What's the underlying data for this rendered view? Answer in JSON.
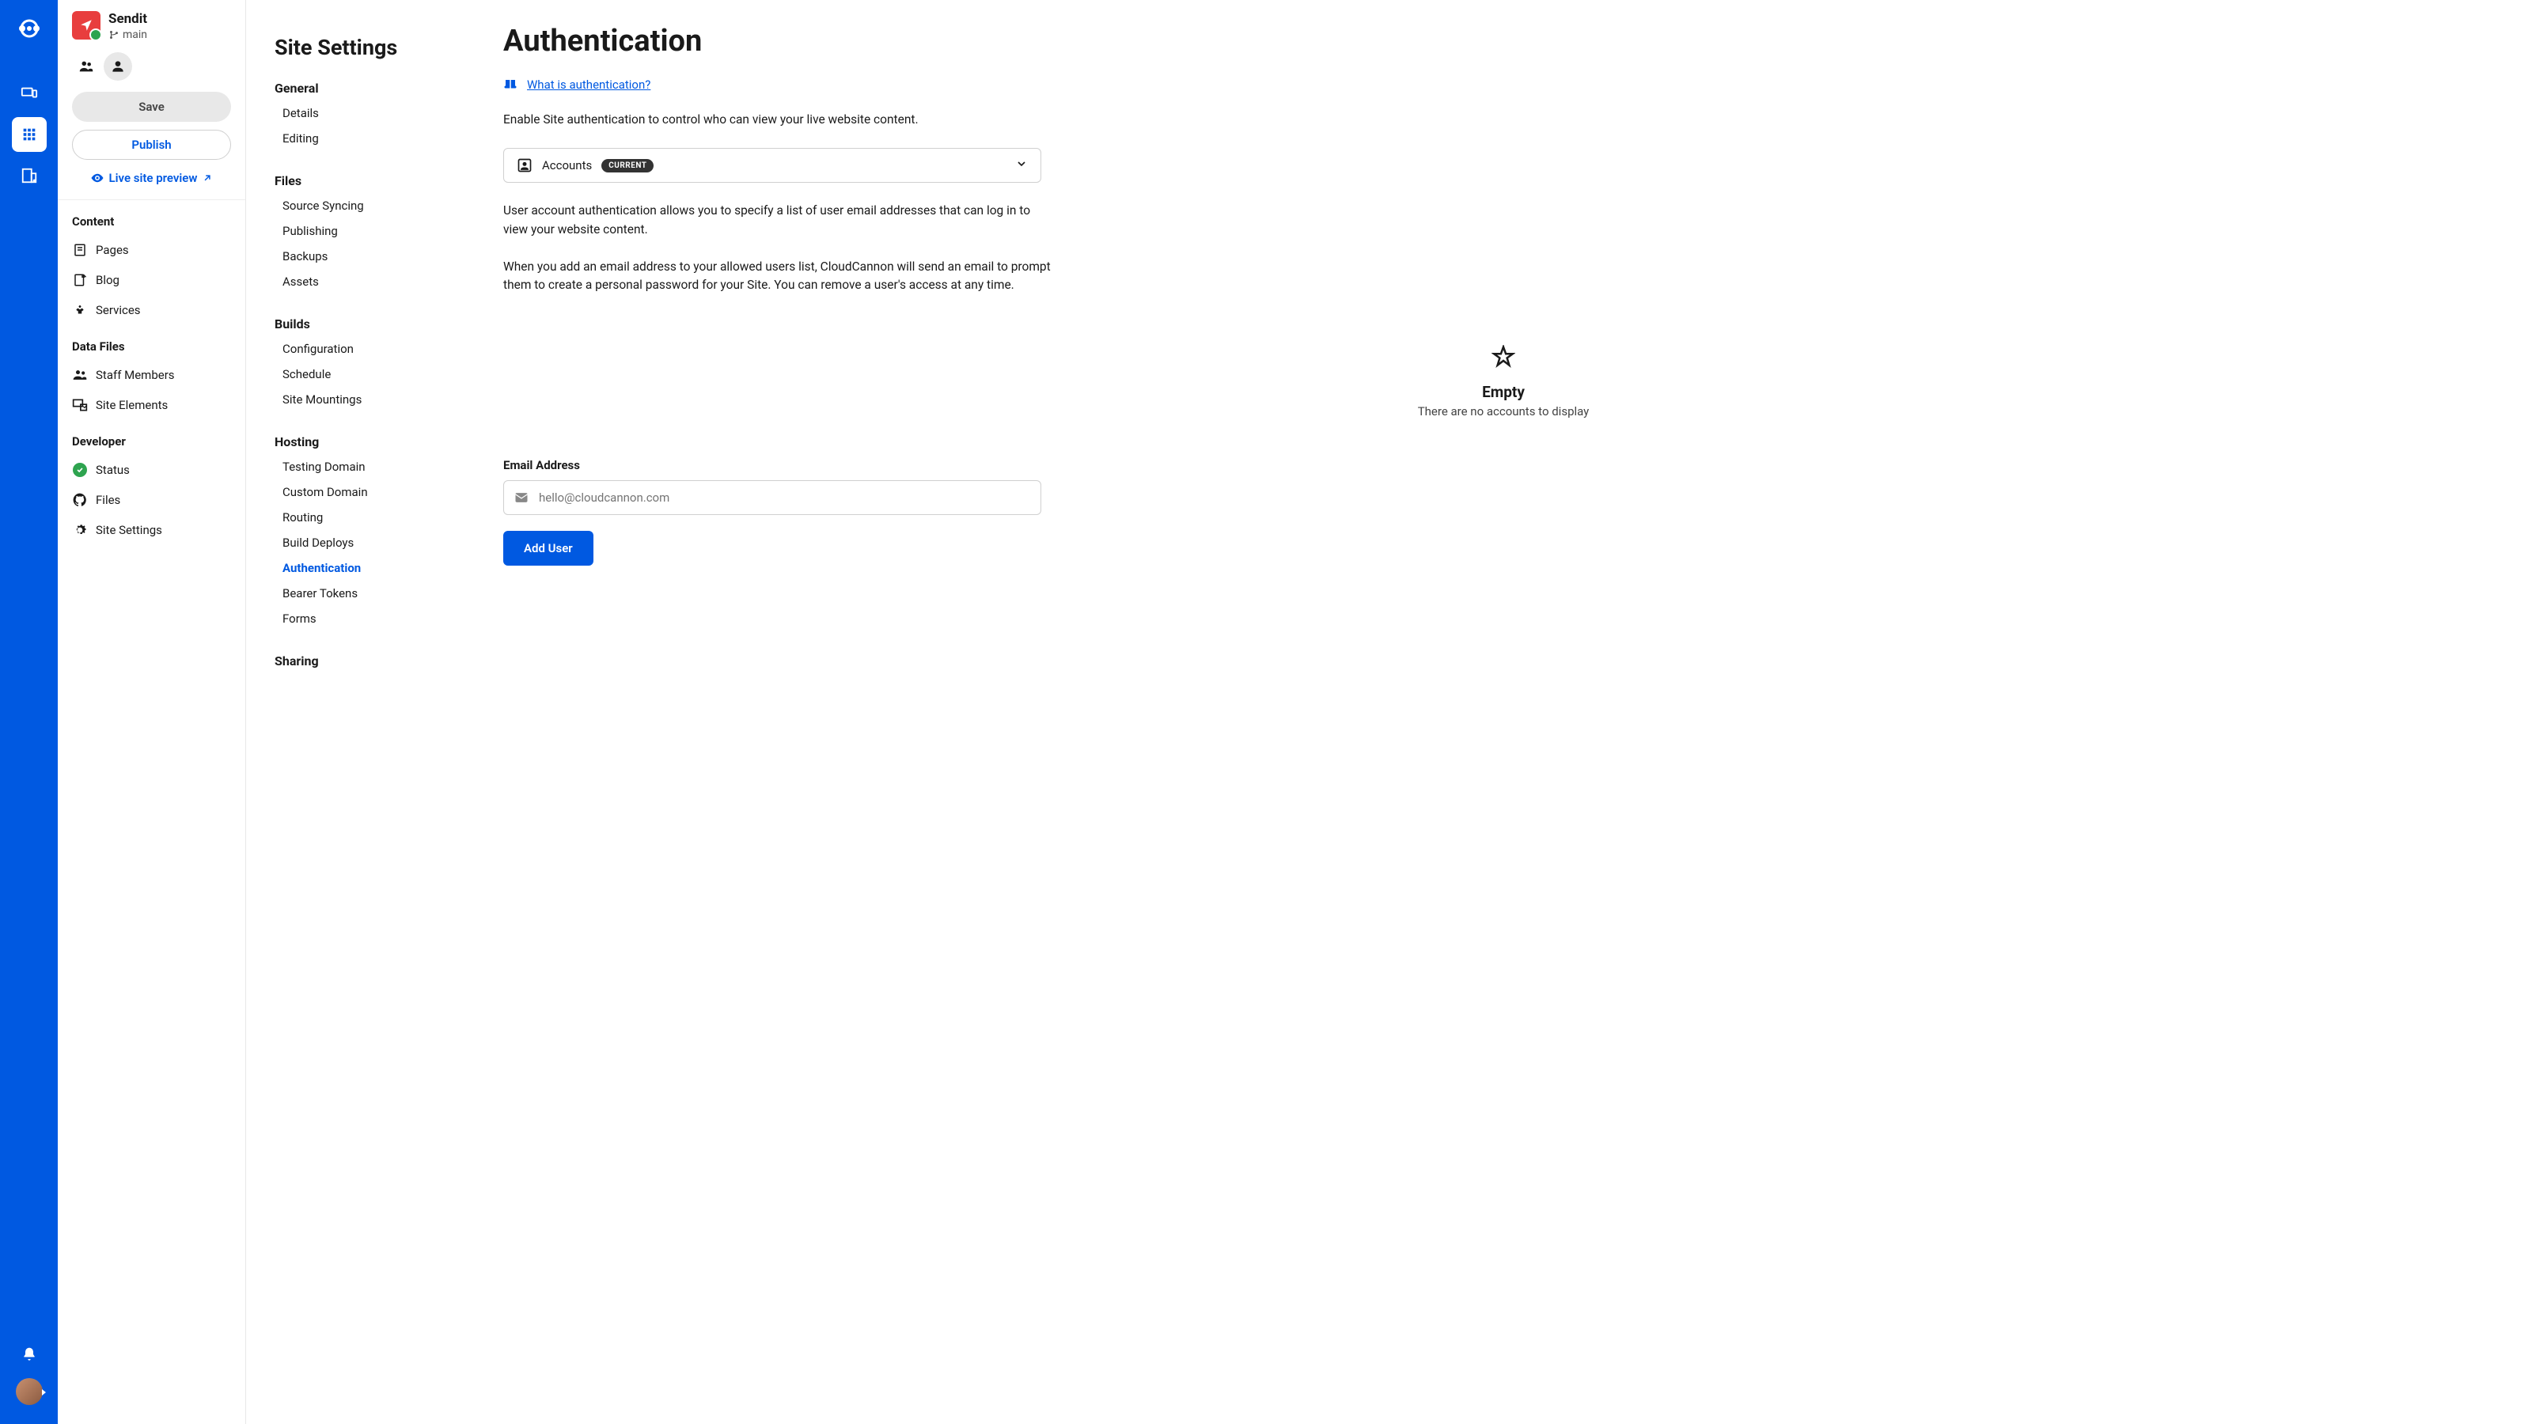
{
  "site": {
    "name": "Sendit",
    "branch": "main"
  },
  "actions": {
    "save_label": "Save",
    "publish_label": "Publish",
    "live_preview": "Live site preview"
  },
  "nav": {
    "content": {
      "heading": "Content",
      "items": [
        "Pages",
        "Blog",
        "Services"
      ]
    },
    "data_files": {
      "heading": "Data Files",
      "items": [
        "Staff Members",
        "Site Elements"
      ]
    },
    "developer": {
      "heading": "Developer",
      "items": [
        "Status",
        "Files",
        "Site Settings"
      ]
    }
  },
  "settings": {
    "title": "Site Settings",
    "general": {
      "heading": "General",
      "items": [
        "Details",
        "Editing"
      ]
    },
    "files": {
      "heading": "Files",
      "items": [
        "Source Syncing",
        "Publishing",
        "Backups",
        "Assets"
      ]
    },
    "builds": {
      "heading": "Builds",
      "items": [
        "Configuration",
        "Schedule",
        "Site Mountings"
      ]
    },
    "hosting": {
      "heading": "Hosting",
      "items": [
        "Testing Domain",
        "Custom Domain",
        "Routing",
        "Build Deploys",
        "Authentication",
        "Bearer Tokens",
        "Forms"
      ]
    },
    "sharing": {
      "heading": "Sharing"
    }
  },
  "main": {
    "title": "Authentication",
    "help_link": "What is authentication?",
    "intro": "Enable Site authentication to control who can view your live website content.",
    "selector": {
      "label": "Accounts",
      "badge": "CURRENT"
    },
    "para1": "User account authentication allows you to specify a list of user email addresses that can log in to view your website content.",
    "para2": "When you add an email address to your allowed users list, CloudCannon will send an email to prompt them to create a personal password for your Site. You can remove a user's access at any time.",
    "empty": {
      "title": "Empty",
      "text": "There are no accounts to display"
    },
    "email": {
      "label": "Email Address",
      "placeholder": "hello@cloudcannon.com"
    },
    "add_user": "Add User"
  }
}
